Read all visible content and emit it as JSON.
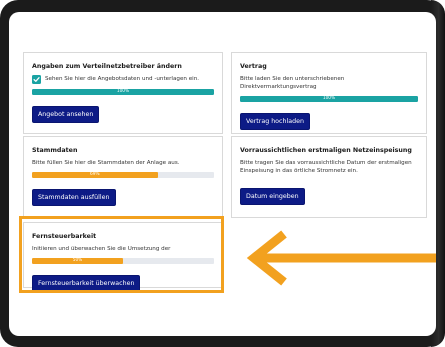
{
  "cards": {
    "distributor": {
      "title": "Angaben zum Verteilnetzbetreiber ändern",
      "checkbox_label": "Sehen Sie hier die Angebotsdaten und -unterlagen ein.",
      "progress_label": "100%",
      "progress": 1.0,
      "button_label": "Angebot ansehen"
    },
    "contract": {
      "title": "Vertrag",
      "text": "Bitte laden Sie den unterschriebenen Direktvermarktungsvertrag",
      "progress_label": "100%",
      "progress": 1.0,
      "button_label": "Vertrag hochladen"
    },
    "master_data": {
      "title": "Stammdaten",
      "text": "Bitte füllen Sie hier die Stammdaten der Anlage aus.",
      "progress_label": "69%",
      "progress": 0.69,
      "button_label": "Stammdaten ausfüllen"
    },
    "feed_in": {
      "title": "Vorraussichtlichen erstmaligen Netzeinspeisung",
      "text": "Bitte tragen Sie das vorraussichtliche Datum der erstmaligen Einspeisung in das örtliche Stromnetz ein.",
      "button_label": "Datum eingeben"
    },
    "remote_control": {
      "title": "Fernsteuerbarkeit",
      "text": "Initiieren und überwachen Sie die Umsetzung der",
      "progress_label": "50%",
      "progress": 0.5,
      "button_label": "Fernsteuerbarkeit überwachen"
    }
  },
  "colors": {
    "teal": "#1aa3a3",
    "orange": "#f2a11f",
    "button": "#0d1b86"
  },
  "icons": {
    "checkbox": "check-icon",
    "arrow": "arrow-left-icon"
  }
}
